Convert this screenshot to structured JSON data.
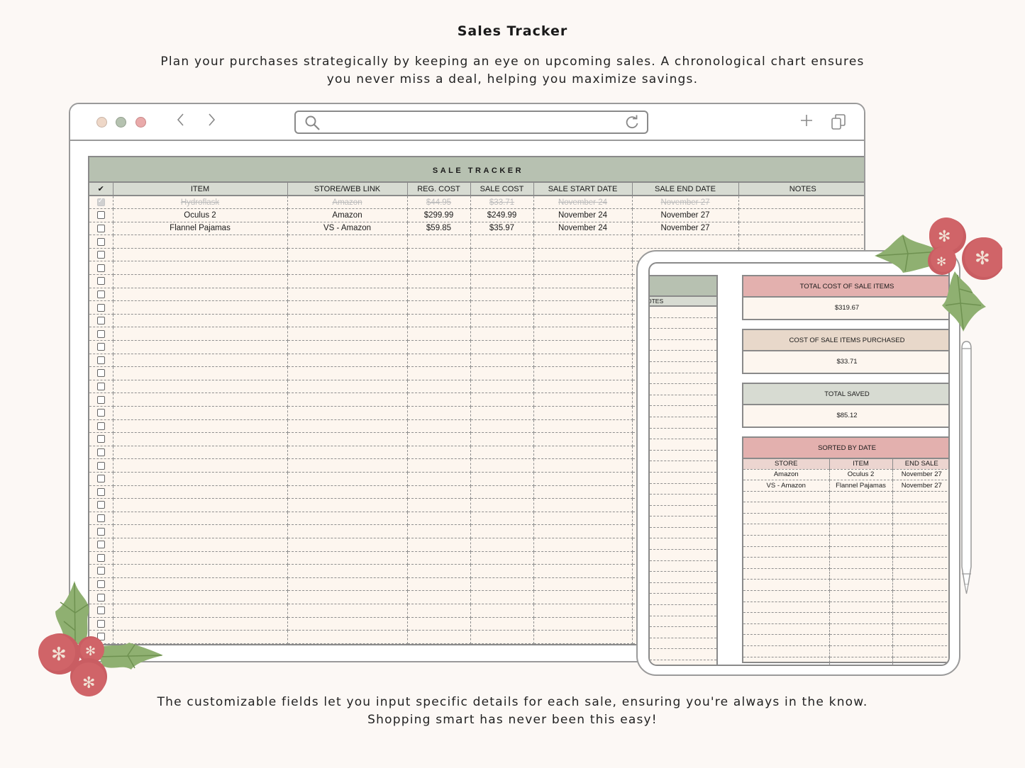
{
  "page": {
    "headline": "Sales Tracker",
    "intro": "Plan your purchases strategically by keeping an eye on upcoming sales. A chronological chart ensures you never miss a deal, helping you maximize savings.",
    "intro_line1": "Plan your purchases strategically by keeping an eye on upcoming sales. A chronological chart ensures",
    "intro_line2": "you never miss a deal, helping you maximize savings.",
    "outro_line1": "The customizable fields let you input specific details for each sale, ensuring you're always in the know.",
    "outro_line2": "Shopping smart has never been this easy!"
  },
  "browser": {
    "window_dots": [
      {
        "name": "window-dot-1",
        "color": "#eed7c7"
      },
      {
        "name": "window-dot-2",
        "color": "#b5c2b0"
      },
      {
        "name": "window-dot-3",
        "color": "#e9aaaa"
      }
    ],
    "icons": {
      "back": "‹",
      "forward": "›",
      "search": "search-icon",
      "reload": "reload-icon",
      "new_tab": "+",
      "tabs": "tabs-icon"
    },
    "url": ""
  },
  "tracker": {
    "title": "SALE TRACKER",
    "columns": [
      "✔",
      "ITEM",
      "STORE/WEB LINK",
      "REG. COST",
      "SALE COST",
      "SALE START DATE",
      "SALE END DATE",
      "NOTES"
    ],
    "rows": [
      {
        "checked": true,
        "item": "Hydroflask",
        "store": "Amazon",
        "reg_cost": "$44.95",
        "sale_cost": "$33.71",
        "start": "November 24",
        "end": "November 27",
        "notes": ""
      },
      {
        "checked": false,
        "item": "Oculus 2",
        "store": "Amazon",
        "reg_cost": "$299.99",
        "sale_cost": "$249.99",
        "start": "November 24",
        "end": "November 27",
        "notes": ""
      },
      {
        "checked": false,
        "item": "Flannel Pajamas",
        "store": "VS - Amazon",
        "reg_cost": "$59.85",
        "sale_cost": "$35.97",
        "start": "November 24",
        "end": "November 27",
        "notes": ""
      }
    ],
    "empty_rows": 31
  },
  "tablet": {
    "left_panel_header": "OTES",
    "summary": [
      {
        "label": "TOTAL COST OF SALE ITEMS",
        "value": "$319.67",
        "color": "#e3b0ae"
      },
      {
        "label": "COST OF SALE ITEMS PURCHASED",
        "value": "$33.71",
        "color": "#e8d8ca"
      },
      {
        "label": "TOTAL SAVED",
        "value": "$85.12",
        "color": "#d7dbd2"
      }
    ],
    "sorted": {
      "title": "SORTED BY DATE",
      "columns": [
        "STORE",
        "ITEM",
        "END SALE"
      ],
      "rows": [
        [
          "Amazon",
          "Oculus 2",
          "November 27"
        ],
        [
          "VS - Amazon",
          "Flannel Pajamas",
          "November 27"
        ]
      ],
      "empty_rows": 16
    }
  },
  "colors": {
    "background": "#fcf8f5",
    "sage_header": "#b7c1b1",
    "column_header": "#d7dbd2",
    "cell_fill": "#fdf6ef",
    "rose": "#e3b0ae",
    "berry": "#d06468",
    "holly_leaf": "#8fb071"
  }
}
